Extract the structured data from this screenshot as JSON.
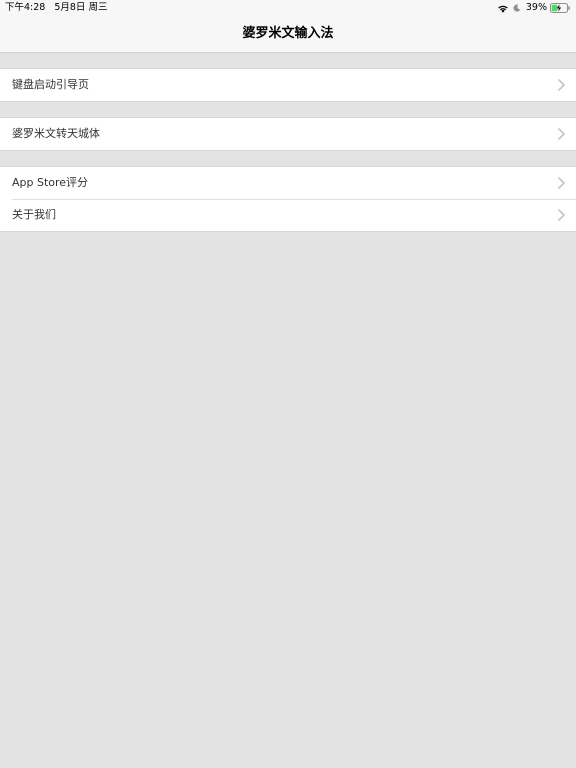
{
  "status_bar": {
    "time": "下午4:28",
    "date": "5月8日 周三",
    "battery_percent": "39%",
    "battery_level": 0.39,
    "icons": [
      "wifi-icon",
      "moon-icon",
      "battery-charging-icon"
    ]
  },
  "nav": {
    "title": "婆罗米文输入法"
  },
  "groups": [
    {
      "items": [
        {
          "label": "键盘启动引导页"
        }
      ]
    },
    {
      "items": [
        {
          "label": "婆罗米文转天城体"
        }
      ]
    },
    {
      "items": [
        {
          "label": "App Store评分"
        },
        {
          "label": "关于我们"
        }
      ]
    }
  ],
  "colors": {
    "background": "#e3e3e3",
    "cell": "#ffffff",
    "chevron": "#c4c4c7",
    "battery_fill": "#4cd964"
  }
}
